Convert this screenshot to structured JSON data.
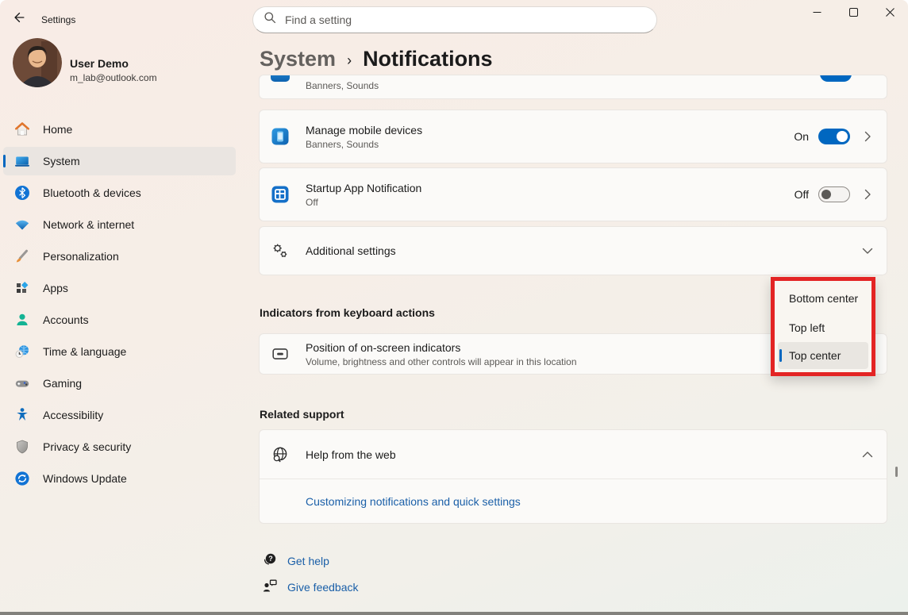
{
  "titlebar": {
    "app_title": "Settings"
  },
  "user": {
    "name": "User Demo",
    "email": "m_lab@outlook.com"
  },
  "search": {
    "placeholder": "Find a setting"
  },
  "sidebar": {
    "items": [
      {
        "label": "Home",
        "icon": "home-icon",
        "selected": false
      },
      {
        "label": "System",
        "icon": "system-icon",
        "selected": true
      },
      {
        "label": "Bluetooth & devices",
        "icon": "bluetooth-icon",
        "selected": false
      },
      {
        "label": "Network & internet",
        "icon": "network-icon",
        "selected": false
      },
      {
        "label": "Personalization",
        "icon": "personalization-icon",
        "selected": false
      },
      {
        "label": "Apps",
        "icon": "apps-icon",
        "selected": false
      },
      {
        "label": "Accounts",
        "icon": "accounts-icon",
        "selected": false
      },
      {
        "label": "Time & language",
        "icon": "time-language-icon",
        "selected": false
      },
      {
        "label": "Gaming",
        "icon": "gaming-icon",
        "selected": false
      },
      {
        "label": "Accessibility",
        "icon": "accessibility-icon",
        "selected": false
      },
      {
        "label": "Privacy & security",
        "icon": "privacy-icon",
        "selected": false
      },
      {
        "label": "Windows Update",
        "icon": "windows-update-icon",
        "selected": false
      }
    ]
  },
  "breadcrumb": {
    "parent": "System",
    "separator": "›",
    "current": "Notifications"
  },
  "content": {
    "partial_row": {
      "subtitle": "Banners, Sounds"
    },
    "rows": [
      {
        "title": "Manage mobile devices",
        "subtitle": "Banners, Sounds",
        "toggle_label": "On",
        "toggle_state": "on"
      },
      {
        "title": "Startup App Notification",
        "subtitle": "Off",
        "toggle_label": "Off",
        "toggle_state": "off"
      }
    ],
    "additional_settings_label": "Additional settings",
    "keyboard_section": {
      "heading": "Indicators from keyboard actions",
      "row_title": "Position of on-screen indicators",
      "row_subtitle": "Volume, brightness and other controls will appear in this location"
    },
    "position_dropdown": {
      "options": [
        {
          "label": "Bottom center",
          "selected": false
        },
        {
          "label": "Top left",
          "selected": false
        },
        {
          "label": "Top center",
          "selected": true
        }
      ]
    },
    "related_support": {
      "heading": "Related support",
      "help_row_title": "Help from the web",
      "link_label": "Customizing notifications and quick settings"
    },
    "footer_links": [
      {
        "label": "Get help"
      },
      {
        "label": "Give feedback"
      }
    ]
  },
  "colors": {
    "accent": "#0067c0",
    "link": "#1a5fa8",
    "annotation": "#e32424"
  }
}
